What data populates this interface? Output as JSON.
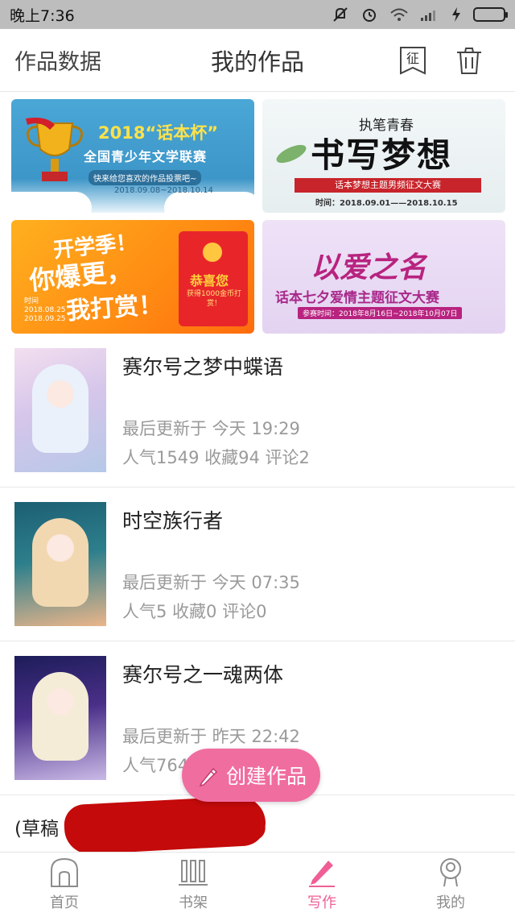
{
  "status_bar": {
    "time": "晚上7:36"
  },
  "header": {
    "left_link": "作品数据",
    "title": "我的作品",
    "seal_icon_char": "征"
  },
  "banners": [
    {
      "headline": "2018“话本杯”",
      "subtitle": "全国青少年文学联赛",
      "tag": "快来给您喜欢的作品投票吧~",
      "dates": "2018.09.08~2018.10.14"
    },
    {
      "kicker": "执笔青春",
      "title": "书写梦想",
      "ribbon": "话本梦想主题男频征文大赛",
      "dates": "时间：2018.09.01——2018.10.15"
    },
    {
      "line1": "开学季！",
      "line2": "你爆更，",
      "line3": "我打赏！",
      "time_label": "时间",
      "date_start": "2018.08.25",
      "date_end": "2018.09.25",
      "envelope_title": "恭喜您",
      "envelope_text": "获得1000金币打赏！"
    },
    {
      "title": "以爱之名",
      "subtitle": "话本七夕爱情主题征文大赛",
      "dates": "参赛时间：2018年8月16日~2018年10月07日"
    }
  ],
  "works": [
    {
      "title": "赛尔号之梦中蝶语",
      "updated": "最后更新于 今天 19:29",
      "stats": "人气1549 收藏94 评论2"
    },
    {
      "title": "时空族行者",
      "updated": "最后更新于 今天 07:35",
      "stats": "人气5 收藏0 评论0"
    },
    {
      "title": "赛尔号之一魂两体",
      "updated": "最后更新于 昨天 22:42",
      "stats": "人气764"
    }
  ],
  "draft": {
    "label": "(草稿"
  },
  "fab": {
    "label": "创建作品"
  },
  "bottom_nav": [
    {
      "label": "首页",
      "icon": "home-icon",
      "active": false
    },
    {
      "label": "书架",
      "icon": "bookshelf-icon",
      "active": false
    },
    {
      "label": "写作",
      "icon": "pen-icon",
      "active": true
    },
    {
      "label": "我的",
      "icon": "profile-icon",
      "active": false
    }
  ],
  "colors": {
    "accent": "#ef5f95",
    "fab": "#f06da0",
    "status_bar": "#bdbdbd"
  }
}
